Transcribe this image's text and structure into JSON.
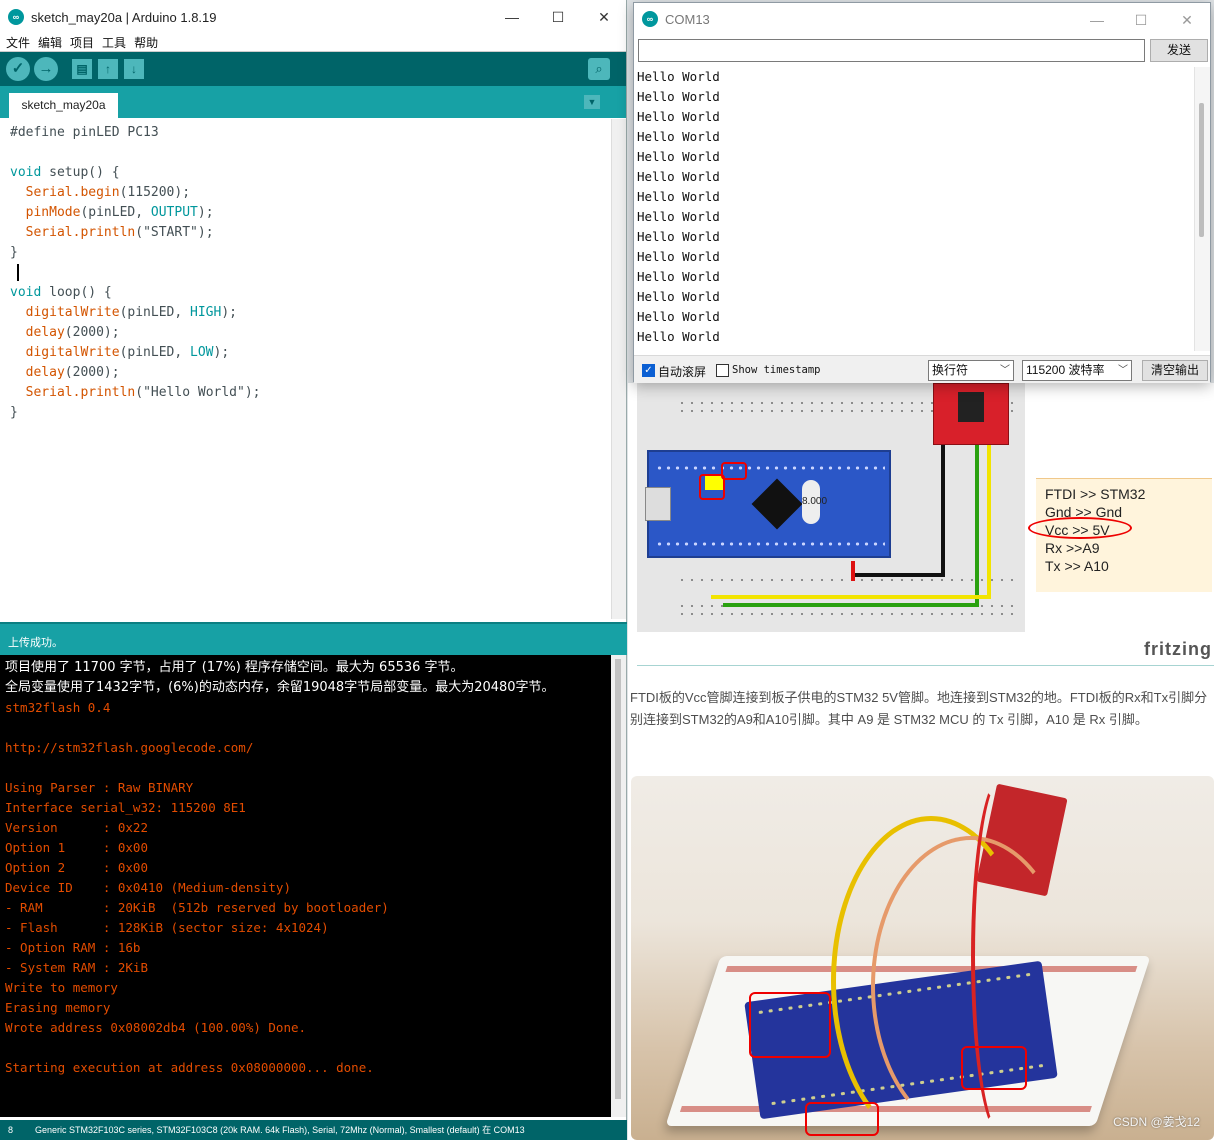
{
  "ide": {
    "title": "sketch_may20a | Arduino 1.8.19",
    "window_controls": [
      "—",
      "☐",
      "✕"
    ],
    "menu": [
      "文件",
      "编辑",
      "项目",
      "工具",
      "帮助"
    ],
    "tab_label": "sketch_may20a",
    "code": {
      "l1": "#define pinLED PC13",
      "setup_sig_kw": "void",
      "setup_sig": " setup() {",
      "serial1": "Serial",
      "begin": ".begin",
      "begin_args": "(115200);",
      "pinmode": "pinMode",
      "pinmode_args": "(pinLED, ",
      "output_const": "OUTPUT",
      "close_paren": ");",
      "serial2": "Serial",
      "println1": ".println",
      "println1_args": "(\"START\");",
      "brace_close": "}",
      "loop_sig_kw": "void",
      "loop_sig": " loop() {",
      "dw1": "digitalWrite",
      "dw1_args": "(pinLED, ",
      "high": "HIGH",
      "delay1": "delay",
      "delay1_args": "(2000);",
      "dw2": "digitalWrite",
      "dw2_args": "(pinLED, ",
      "low": "LOW",
      "delay2": "delay",
      "delay2_args": "(2000);",
      "serial3": "Serial",
      "println2": ".println",
      "println2_args": "(\"Hello World\");"
    },
    "status": "上传成功。",
    "console": {
      "white": [
        "项目使用了 11700 字节，占用了 (17%) 程序存储空间。最大为 65536 字节。",
        "全局变量使用了1432字节，(6%)的动态内存，余留19048字节局部变量。最大为20480字节。"
      ],
      "orange": [
        "stm32flash 0.4",
        "",
        "http://stm32flash.googlecode.com/",
        "",
        "Using Parser : Raw BINARY",
        "Interface serial_w32: 115200 8E1",
        "Version      : 0x22",
        "Option 1     : 0x00",
        "Option 2     : 0x00",
        "Device ID    : 0x0410 (Medium-density)",
        "- RAM        : 20KiB  (512b reserved by bootloader)",
        "- Flash      : 128KiB (sector size: 4x1024)",
        "- Option RAM : 16b",
        "- System RAM : 2KiB",
        "Write to memory",
        "Erasing memory",
        "Wrote address 0x08002db4 (100.00%) Done.",
        "",
        "Starting execution at address 0x08000000... done."
      ]
    },
    "footer_line": "8",
    "footer_board": "Generic STM32F103C series, STM32F103C8 (20k RAM. 64k Flash), Serial, 72Mhz (Normal), Smallest (default) 在 COM13"
  },
  "serial": {
    "title": "COM13",
    "window_controls": [
      "—",
      "☐",
      "✕"
    ],
    "input_value": "",
    "send_label": "发送",
    "lines": [
      "Hello World",
      "Hello World",
      "Hello World",
      "Hello World",
      "Hello World",
      "Hello World",
      "Hello World",
      "Hello World",
      "Hello World",
      "Hello World",
      "Hello World",
      "Hello World",
      "Hello World",
      "Hello World"
    ],
    "autoscroll_label": "自动滚屏",
    "autoscroll_checked": true,
    "timestamp_label": "Show timestamp",
    "timestamp_checked": false,
    "line_ending": "换行符",
    "baud": "115200 波特率",
    "clear_label": "清空输出"
  },
  "page": {
    "note_lines": [
      "FTDI >> STM32",
      "Gnd >> Gnd",
      "Vcc >> 5V",
      "Rx >>A9",
      "Tx >> A10"
    ],
    "fritzing_label": "fritzing",
    "paragraph": "FTDI板的Vcc管脚连接到板子供电的STM32 5V管脚。地连接到STM32的地。FTDI板的Rx和Tx引脚分别连接到STM32的A9和A10引脚。其中 A9 是 STM32 MCU 的 Tx 引脚，A10 是 Rx 引脚。",
    "watermark": "CSDN @姜戈12",
    "crystal_label": "8.000",
    "colors": {
      "teal_dark": "#006468",
      "teal": "#17a1a5",
      "console_orange": "#e34c00",
      "highlight_red": "#ee0000"
    }
  }
}
